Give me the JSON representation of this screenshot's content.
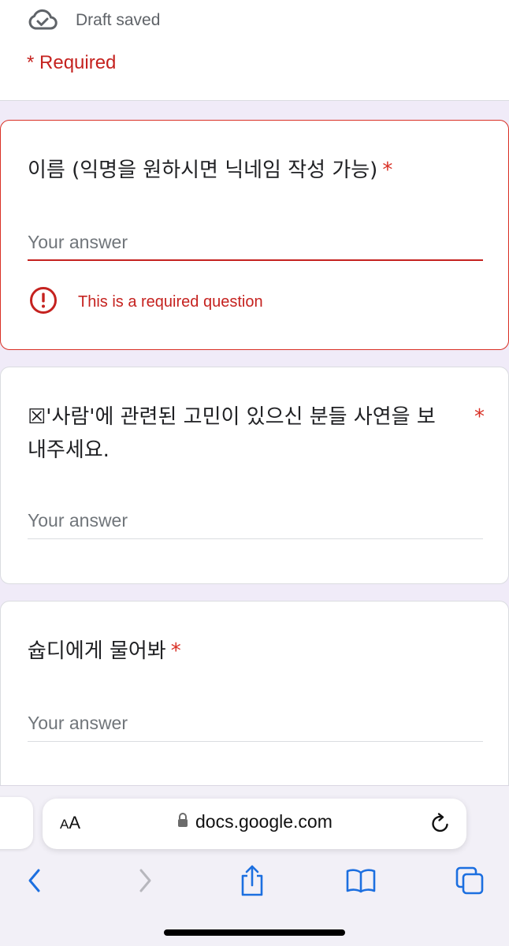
{
  "header": {
    "draft_status": "Draft saved",
    "required_note": "* Required",
    "icon": "cloud-check-icon"
  },
  "questions": [
    {
      "title": "이름 (익명을 원하시면 닉네임 작성 가능)",
      "required_mark": "*",
      "placeholder": "Your answer",
      "value": "",
      "error": "This is a required question",
      "error_icon": "error-circle-icon"
    },
    {
      "title_line1": "☒'사람'에 관련된 고민이 있으신 분들 사연을 보",
      "title_line2": "내주세요.",
      "required_mark": "*",
      "placeholder": "Your answer",
      "value": ""
    },
    {
      "title": "슙디에게 물어봐",
      "required_mark": "*",
      "placeholder": "Your answer",
      "value": ""
    }
  ],
  "browser": {
    "text_size_label_small": "A",
    "text_size_label_large": "A",
    "url": "docs.google.com",
    "icons": [
      "lock-icon",
      "reload-icon",
      "back-icon",
      "forward-icon",
      "share-icon",
      "bookmarks-icon",
      "tabs-icon"
    ]
  },
  "colors": {
    "error": "#c5221f",
    "background": "#f0ebf8",
    "link_blue": "#1a73e8",
    "ios_blue": "#1c6fe0"
  }
}
